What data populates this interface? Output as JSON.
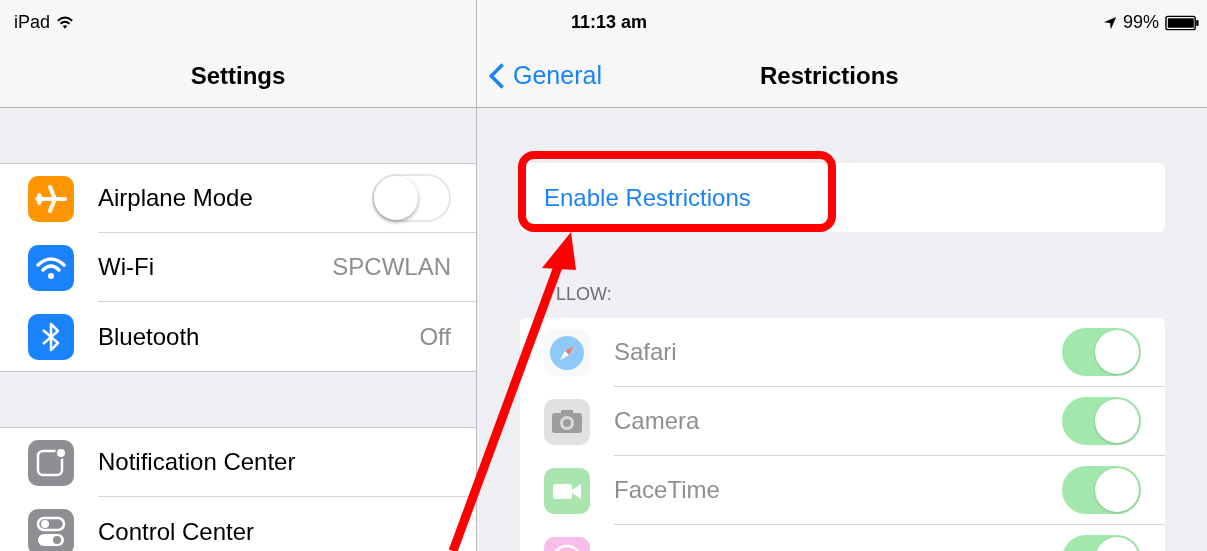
{
  "status_bar": {
    "carrier": "iPad",
    "time": "11:13 am",
    "battery": "99%"
  },
  "settings": {
    "title": "Settings",
    "groups": [
      [
        {
          "label": "Airplane Mode",
          "kind": "toggle",
          "on": false
        },
        {
          "label": "Wi-Fi",
          "kind": "value",
          "value": "SPCWLAN"
        },
        {
          "label": "Bluetooth",
          "kind": "value",
          "value": "Off"
        }
      ],
      [
        {
          "label": "Notification Center",
          "kind": "link"
        },
        {
          "label": "Control Center",
          "kind": "link"
        }
      ]
    ]
  },
  "restrictions": {
    "back": "General",
    "title": "Restrictions",
    "enable": "Enable Restrictions",
    "section": "LLOW:",
    "items": [
      {
        "label": "Safari",
        "on": true,
        "disabled": true
      },
      {
        "label": "Camera",
        "on": true,
        "disabled": true
      },
      {
        "label": "FaceTime",
        "on": true,
        "disabled": true
      },
      {
        "on": true,
        "disabled": true
      }
    ]
  }
}
